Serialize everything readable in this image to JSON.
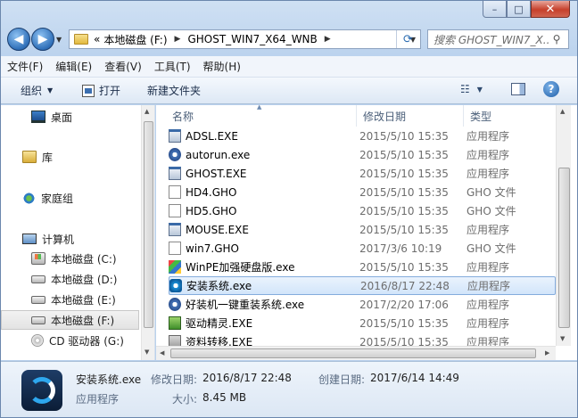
{
  "window": {
    "controls": {
      "minimize": "–",
      "maximize": "□",
      "close": "✕"
    }
  },
  "address": {
    "overflow": "«",
    "crumbs": [
      "本地磁盘 (F:)",
      "GHOST_WIN7_X64_WNB"
    ],
    "search_placeholder": "搜索 GHOST_WIN7_X..."
  },
  "menu": [
    "文件(F)",
    "编辑(E)",
    "查看(V)",
    "工具(T)",
    "帮助(H)"
  ],
  "toolbar": {
    "organize": "组织",
    "open": "打开",
    "new_folder": "新建文件夹"
  },
  "nav": {
    "desktop": "桌面",
    "libraries": "库",
    "homegroup": "家庭组",
    "computer": "计算机",
    "drives": [
      {
        "label": "本地磁盘 (C:)",
        "icon": "drive-win"
      },
      {
        "label": "本地磁盘 (D:)",
        "icon": "drive"
      },
      {
        "label": "本地磁盘 (E:)",
        "icon": "drive"
      },
      {
        "label": "本地磁盘 (F:)",
        "icon": "drive",
        "selected": true
      },
      {
        "label": "CD 驱动器 (G:)",
        "icon": "cd"
      }
    ]
  },
  "columns": {
    "name": "名称",
    "date": "修改日期",
    "type": "类型"
  },
  "files": [
    {
      "name": "ADSL.EXE",
      "date": "2015/5/10 15:35",
      "type": "应用程序",
      "icon": "exe"
    },
    {
      "name": "autorun.exe",
      "date": "2015/5/10 15:35",
      "type": "应用程序",
      "icon": "gear"
    },
    {
      "name": "GHOST.EXE",
      "date": "2015/5/10 15:35",
      "type": "应用程序",
      "icon": "exe"
    },
    {
      "name": "HD4.GHO",
      "date": "2015/5/10 15:35",
      "type": "GHO 文件",
      "icon": "gho"
    },
    {
      "name": "HD5.GHO",
      "date": "2015/5/10 15:35",
      "type": "GHO 文件",
      "icon": "gho"
    },
    {
      "name": "MOUSE.EXE",
      "date": "2015/5/10 15:35",
      "type": "应用程序",
      "icon": "exe"
    },
    {
      "name": "win7.GHO",
      "date": "2017/3/6 10:19",
      "type": "GHO 文件",
      "icon": "gho"
    },
    {
      "name": "WinPE加强硬盘版.exe",
      "date": "2015/5/10 15:35",
      "type": "应用程序",
      "icon": "winpe"
    },
    {
      "name": "安装系统.exe",
      "date": "2016/8/17 22:48",
      "type": "应用程序",
      "icon": "setup",
      "selected": true
    },
    {
      "name": "好装机一键重装系统.exe",
      "date": "2017/2/20 17:06",
      "type": "应用程序",
      "icon": "gear"
    },
    {
      "name": "驱动精灵.EXE",
      "date": "2015/5/10 15:35",
      "type": "应用程序",
      "icon": "green"
    },
    {
      "name": "资料转移.EXE",
      "date": "2015/5/10 15:35",
      "type": "应用程序",
      "icon": "grey"
    }
  ],
  "details": {
    "name": "安装系统.exe",
    "modified_label": "修改日期:",
    "modified_value": "2016/8/17 22:48",
    "created_label": "创建日期:",
    "created_value": "2017/6/14 14:49",
    "type": "应用程序",
    "size_label": "大小:",
    "size_value": "8.45 MB"
  }
}
